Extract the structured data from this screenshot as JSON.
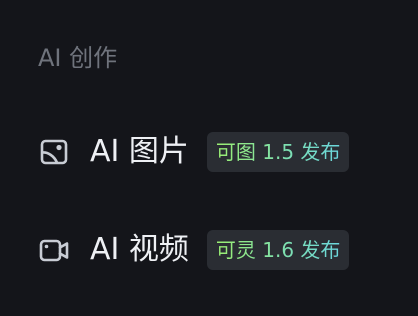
{
  "section": {
    "title": "AI 创作"
  },
  "nav": {
    "items": [
      {
        "icon": "image-icon",
        "label": "AI 图片",
        "badge": "可图 1.5 发布"
      },
      {
        "icon": "video-camera-icon",
        "label": "AI 视频",
        "badge": "可灵 1.6 发布"
      }
    ]
  },
  "colors": {
    "background": "#14151a",
    "section_title": "#6f737c",
    "label": "#eef0f4",
    "icon_stroke": "#c8ccd4",
    "badge_bg": "#2a2d33",
    "badge_text_gradient_start": "#9ef06a",
    "badge_text_gradient_end": "#68d6e6"
  }
}
